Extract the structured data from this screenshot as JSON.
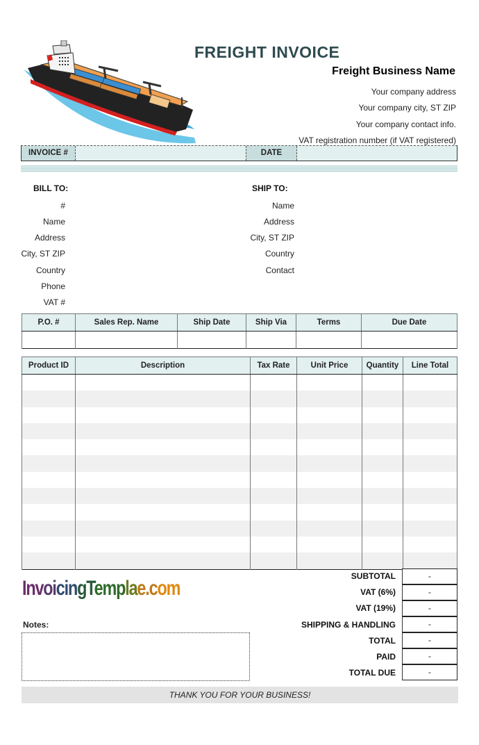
{
  "header": {
    "title": "FREIGHT INVOICE",
    "business_name": "Freight Business Name",
    "address_lines": [
      "Your company address",
      "Your company city, ST ZIP",
      "Your company contact info.",
      "VAT registration number (if VAT registered)"
    ]
  },
  "invoice_bar": {
    "invoice_label": "INVOICE #",
    "invoice_value": "",
    "date_label": "DATE",
    "date_value": ""
  },
  "bill_to": {
    "heading": "BILL TO:",
    "fields": [
      "#",
      "Name",
      "Address",
      "City, ST ZIP",
      "Country",
      "Phone",
      "VAT #"
    ]
  },
  "ship_to": {
    "heading": "SHIP TO:",
    "fields": [
      "Name",
      "Address",
      "City, ST ZIP",
      "Country",
      "Contact"
    ]
  },
  "order_info": {
    "columns": [
      "P.O. #",
      "Sales Rep. Name",
      "Ship Date",
      "Ship Via",
      "Terms",
      "Due Date"
    ],
    "values": [
      "",
      "",
      "",
      "",
      "",
      ""
    ]
  },
  "line_items": {
    "columns": [
      "Product ID",
      "Description",
      "Tax Rate",
      "Unit Price",
      "Quantity",
      "Line Total"
    ],
    "rows": [
      [
        "",
        "",
        "",
        "",
        "",
        ""
      ],
      [
        "",
        "",
        "",
        "",
        "",
        ""
      ],
      [
        "",
        "",
        "",
        "",
        "",
        ""
      ],
      [
        "",
        "",
        "",
        "",
        "",
        ""
      ],
      [
        "",
        "",
        "",
        "",
        "",
        ""
      ],
      [
        "",
        "",
        "",
        "",
        "",
        ""
      ],
      [
        "",
        "",
        "",
        "",
        "",
        ""
      ],
      [
        "",
        "",
        "",
        "",
        "",
        ""
      ],
      [
        "",
        "",
        "",
        "",
        "",
        ""
      ],
      [
        "",
        "",
        "",
        "",
        "",
        ""
      ],
      [
        "",
        "",
        "",
        "",
        "",
        ""
      ],
      [
        "",
        "",
        "",
        "",
        "",
        ""
      ]
    ]
  },
  "logo": {
    "text": "InvoicingTemplae.com",
    "colors": [
      "#6b2d6b",
      "#5a3a6e",
      "#2e4a6b",
      "#2a5a3a",
      "#2f6b2a",
      "#6b7a20",
      "#c07a1a",
      "#e08a10"
    ]
  },
  "totals": [
    {
      "label": "SUBTOTAL",
      "value": "-"
    },
    {
      "label": "VAT (6%)",
      "value": "-"
    },
    {
      "label": "VAT (19%)",
      "value": "-"
    },
    {
      "label": "SHIPPING & HANDLING",
      "value": "-"
    },
    {
      "label": "TOTAL",
      "value": "-"
    },
    {
      "label": "PAID",
      "value": "-"
    },
    {
      "label": "TOTAL DUE",
      "value": "-"
    }
  ],
  "notes": {
    "label": "Notes:",
    "value": ""
  },
  "footer": {
    "thanks": "THANK YOU FOR YOUR BUSINESS!"
  }
}
